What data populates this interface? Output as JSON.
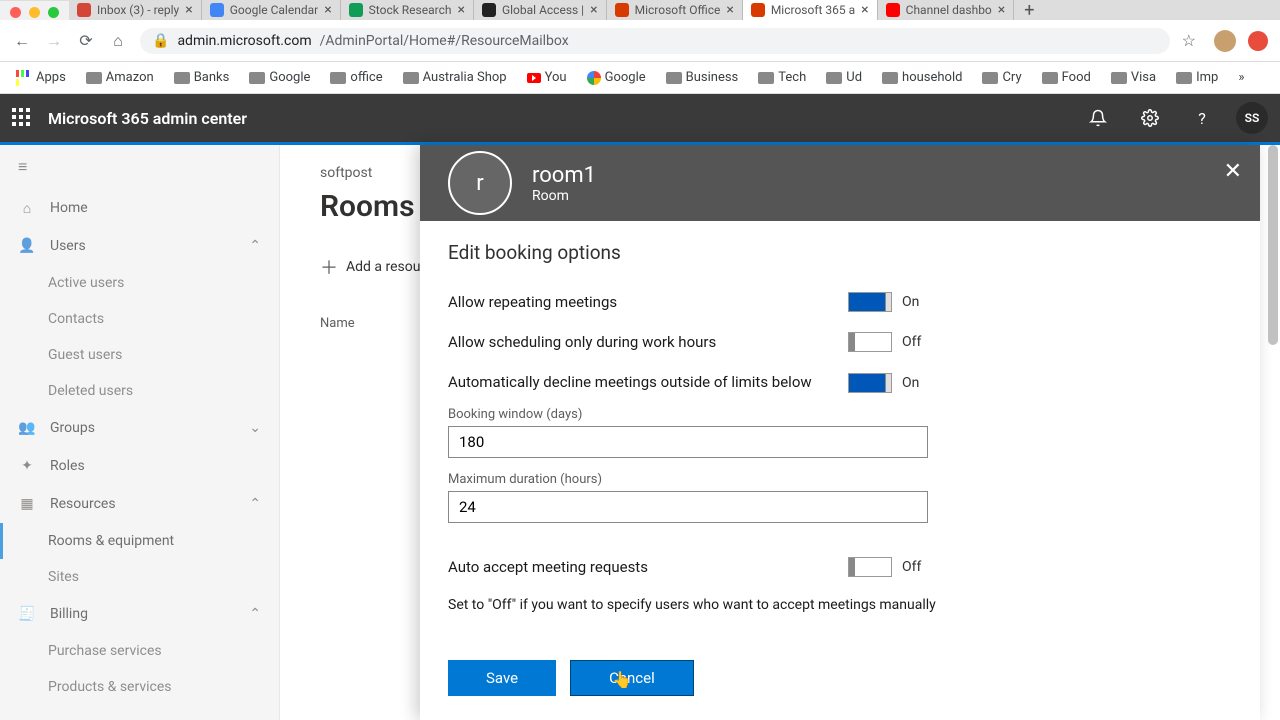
{
  "browser": {
    "tabs": [
      {
        "label": "Inbox (3) - reply",
        "fav": "gmail"
      },
      {
        "label": "Google Calendar",
        "fav": "gcal"
      },
      {
        "label": "Stock Research",
        "fav": "gsheets"
      },
      {
        "label": "Global Access |",
        "fav": "generic"
      },
      {
        "label": "Microsoft Office",
        "fav": "ms"
      },
      {
        "label": "Microsoft 365 a",
        "fav": "m365",
        "active": true
      },
      {
        "label": "Channel dashbo",
        "fav": "yt"
      }
    ],
    "url_host": "admin.microsoft.com",
    "url_path": "/AdminPortal/Home#/ResourceMailbox",
    "bookmarks": [
      "Apps",
      "Amazon",
      "Banks",
      "Google",
      "office",
      "Australia Shop",
      "You",
      "Google",
      "Business",
      "Tech",
      "Ud",
      "household",
      "Cry",
      "Food",
      "Visa",
      "Imp"
    ]
  },
  "portal": {
    "title": "Microsoft 365 admin center",
    "avatar": "SS"
  },
  "sidebar": {
    "items": [
      {
        "label": "Home"
      },
      {
        "label": "Users",
        "expandable": true
      },
      {
        "label": "Active users",
        "sub": true
      },
      {
        "label": "Contacts",
        "sub": true
      },
      {
        "label": "Guest users",
        "sub": true
      },
      {
        "label": "Deleted users",
        "sub": true
      },
      {
        "label": "Groups",
        "expandable": true
      },
      {
        "label": "Roles"
      },
      {
        "label": "Resources",
        "expandable": true
      },
      {
        "label": "Rooms & equipment",
        "sub": true,
        "selected": true
      },
      {
        "label": "Sites",
        "sub": true
      },
      {
        "label": "Billing",
        "expandable": true
      },
      {
        "label": "Purchase services",
        "sub": true
      },
      {
        "label": "Products & services",
        "sub": true
      }
    ]
  },
  "page": {
    "breadcrumb": "softpost",
    "title": "Rooms",
    "add_btn": "Add a resource",
    "col_name": "Name"
  },
  "panel": {
    "avatar_initial": "r",
    "title": "room1",
    "subtitle": "Room",
    "heading": "Edit booking options",
    "opt1_label": "Allow repeating meetings",
    "opt1_state": "On",
    "opt2_label": "Allow scheduling only during work hours",
    "opt2_state": "Off",
    "opt3_label": "Automatically decline meetings outside of limits below",
    "opt3_state": "On",
    "fld1_label": "Booking window (days)",
    "fld1_value": "180",
    "fld2_label": "Maximum duration (hours)",
    "fld2_value": "24",
    "opt4_label": "Auto accept meeting requests",
    "opt4_state": "Off",
    "help": "Set to \"Off\" if you want to specify users who want to accept meetings manually",
    "save": "Save",
    "cancel": "Cancel"
  }
}
